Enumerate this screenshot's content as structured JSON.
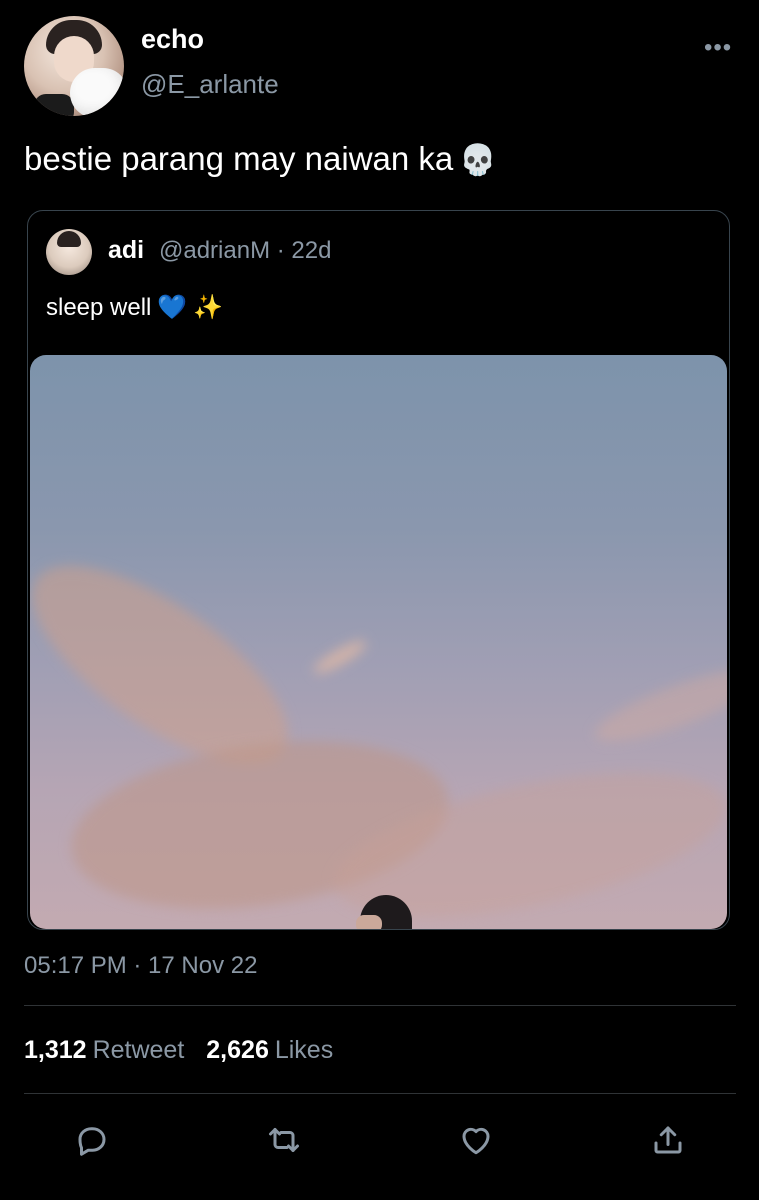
{
  "author": {
    "display_name": "echo",
    "handle": "@E_arlante"
  },
  "more_icon": "ellipsis-icon",
  "tweet": {
    "text": "bestie parang may naiwan ka",
    "emoji": "💀"
  },
  "quoted_tweet": {
    "name": "adi",
    "handle_time": "@adrianM · 22d",
    "text": "sleep well",
    "emoji_heart": "💙",
    "emoji_sparkles": "✨"
  },
  "meta": {
    "timestamp": "05:17 PM · 17 Nov 22"
  },
  "stats": {
    "retweets_count": "1,312",
    "retweets_label": "Retweet",
    "likes_count": "2,626",
    "likes_label": "Likes"
  },
  "actions": {
    "reply_icon": "reply-icon",
    "retweet_icon": "retweet-icon",
    "like_icon": "heart-icon",
    "share_icon": "share-icon",
    "icon_color": "#8b98a5"
  },
  "colors": {
    "background": "#000000",
    "text_primary": "#ffffff",
    "text_secondary": "#8b98a5",
    "border": "#38444d"
  }
}
